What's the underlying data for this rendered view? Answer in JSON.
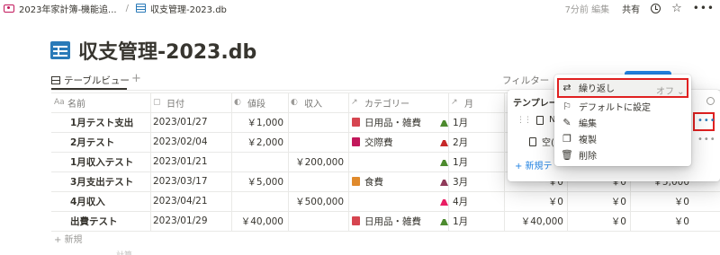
{
  "topbar": {
    "crumb1": "2023年家計簿-機能追...",
    "sep": "/",
    "crumb2": "収支管理-2023.db",
    "edited": "7分前 編集",
    "share": "共有"
  },
  "title": "収支管理-2023.db",
  "view_tab": "テーブルビュー",
  "add_view": "+",
  "toolbar": {
    "filter": "フィルター"
  },
  "columns": [
    {
      "icon": "Aa",
      "label": "名前"
    },
    {
      "icon": "▢",
      "label": "日付"
    },
    {
      "icon": "◐",
      "label": "値段"
    },
    {
      "icon": "◐",
      "label": "収入"
    },
    {
      "icon": "↗",
      "label": "カテゴリー"
    },
    {
      "icon": "↗",
      "label": "月"
    }
  ],
  "rows": [
    {
      "name": "1月テスト支出",
      "date": "2023/01/27",
      "price": "￥1,000",
      "income": "",
      "category": "日用品・雑費",
      "cat_color": "#d64550",
      "month": "1月",
      "m_color": "#4c8a2e",
      "c7": "",
      "c8": "",
      "c9": ""
    },
    {
      "name": "2月テスト",
      "date": "2023/02/04",
      "price": "￥2,000",
      "income": "",
      "category": "交際費",
      "cat_color": "#c2185b",
      "month": "2月",
      "m_color": "#c62828",
      "c7": "",
      "c8": "",
      "c9": ""
    },
    {
      "name": "1月収入テスト",
      "date": "2023/01/21",
      "price": "",
      "income": "￥200,000",
      "category": "",
      "cat_color": "",
      "month": "1月",
      "m_color": "#4c8a2e",
      "c7": "",
      "c8": "",
      "c9": ""
    },
    {
      "name": "3月支出テスト",
      "date": "2023/03/17",
      "price": "￥5,000",
      "income": "",
      "category": "食費",
      "cat_color": "#e08a2c",
      "month": "3月",
      "m_color": "#8e3a59",
      "c7": "￥0",
      "c8": "￥0",
      "c9": "￥5,000"
    },
    {
      "name": "4月収入",
      "date": "2023/04/21",
      "price": "",
      "income": "￥500,000",
      "category": "",
      "cat_color": "",
      "month": "4月",
      "m_color": "#e91e63",
      "c7": "￥0",
      "c8": "￥0",
      "c9": "￥0"
    },
    {
      "name": "出費テスト",
      "date": "2023/01/29",
      "price": "￥40,000",
      "income": "",
      "category": "日用品・雑費",
      "cat_color": "#d64550",
      "month": "1月",
      "m_color": "#4c8a2e",
      "c7": "￥40,000",
      "c8": "￥0",
      "c9": "￥0"
    }
  ],
  "add_row": "+ 新規",
  "calc_hint": "計算",
  "template_panel": {
    "title": "テンプレー",
    "item1": "Ne",
    "item2": "空(",
    "new": "+  新規テ"
  },
  "menu": {
    "repeat": "繰り返し",
    "repeat_value": "オフ ⌄",
    "set_default": "デフォルトに設定",
    "edit": "編集",
    "duplicate": "複製",
    "delete": "削除"
  },
  "colors": {
    "accent": "#2383e2",
    "highlight": "#e02020",
    "db_icon": "#2a7ab8"
  }
}
